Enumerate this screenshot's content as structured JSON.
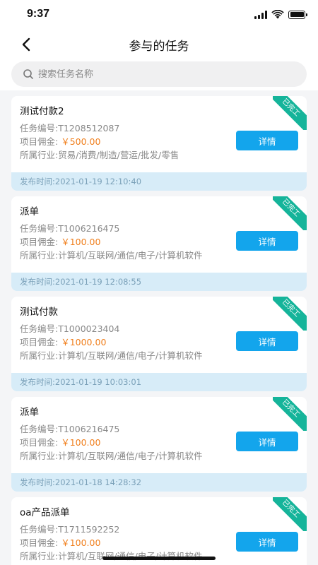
{
  "status_bar": {
    "time": "9:37"
  },
  "nav": {
    "title": "参与的任务"
  },
  "search": {
    "placeholder": "搜索任务名称"
  },
  "labels": {
    "detail_button": "详情",
    "ribbon": "已完工"
  },
  "tasks": [
    {
      "title": "测试付款2",
      "code": "任务编号:T1208512087",
      "commission_label": "项目佣金:",
      "commission": "￥500.00",
      "industry": "所属行业:贸易/消费/制造/营运/批发/零售",
      "published": "发布时间:2021-01-19 12:10:40"
    },
    {
      "title": "派单",
      "code": "任务编号:T1006216475",
      "commission_label": "项目佣金:",
      "commission": "￥100.00",
      "industry": "所属行业:计算机/互联网/通信/电子/计算机软件",
      "published": "发布时间:2021-01-19 12:08:55"
    },
    {
      "title": "测试付款",
      "code": "任务编号:T1000023404",
      "commission_label": "项目佣金:",
      "commission": "￥1000.00",
      "industry": "所属行业:计算机/互联网/通信/电子/计算机软件",
      "published": "发布时间:2021-01-19 10:03:01"
    },
    {
      "title": "派单",
      "code": "任务编号:T1006216475",
      "commission_label": "项目佣金:",
      "commission": "￥100.00",
      "industry": "所属行业:计算机/互联网/通信/电子/计算机软件",
      "published": "发布时间:2021-01-18 14:28:32"
    },
    {
      "title": "oa产品派单",
      "code": "任务编号:T1711592252",
      "commission_label": "项目佣金:",
      "commission": "￥100.00",
      "industry": "所属行业:计算机/互联网/通信/电子/计算机软件",
      "published": ""
    }
  ],
  "colors": {
    "accent": "#13a5ec",
    "price": "#f07e1b",
    "ribbon": "#15b49a",
    "footer_bg": "#d7ecf8"
  }
}
